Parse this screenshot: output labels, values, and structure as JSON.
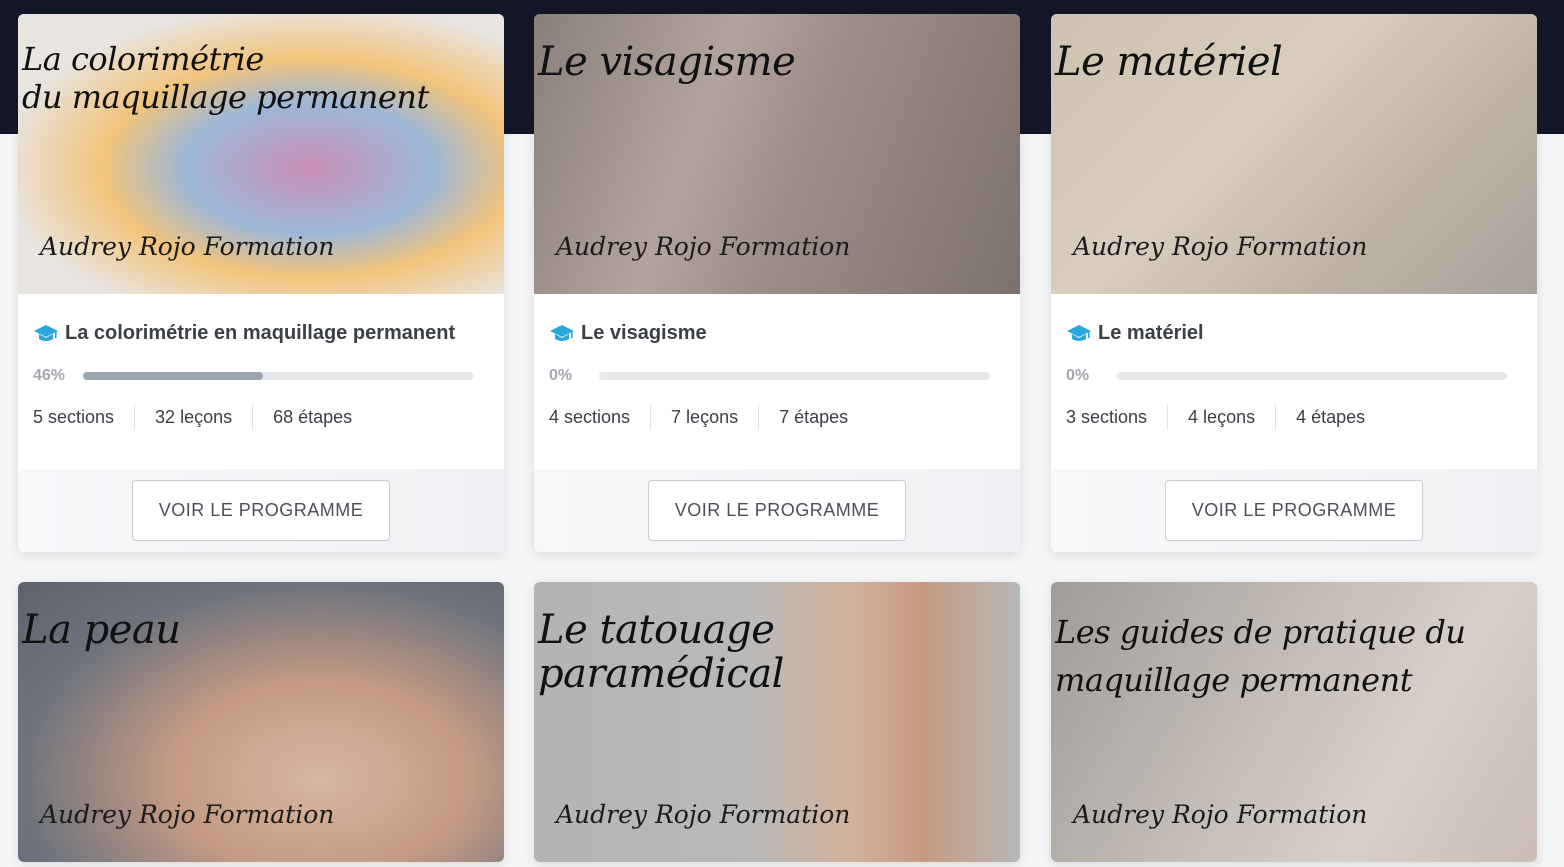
{
  "signature": "Audrey Rojo Formation",
  "button_label": "VOIR LE PROGRAMME",
  "courses": [
    {
      "image_title": "La colorimétrie\ndu maquillage permanent",
      "title": "La colorimétrie en maquillage permanent",
      "progress_label": "46%",
      "progress_fraction": 0.46,
      "stats": [
        "5 sections",
        "32 leçons",
        "68 étapes"
      ]
    },
    {
      "image_title": "Le visagisme",
      "title": "Le visagisme",
      "progress_label": "0%",
      "progress_fraction": 0,
      "stats": [
        "4 sections",
        "7 leçons",
        "7 étapes"
      ]
    },
    {
      "image_title": "Le matériel",
      "title": "Le matériel",
      "progress_label": "0%",
      "progress_fraction": 0,
      "stats": [
        "3 sections",
        "4 leçons",
        "4 étapes"
      ]
    },
    {
      "image_title": "La peau"
    },
    {
      "image_title": "Le tatouage\nparamédical"
    },
    {
      "image_title": "Les guides de pratique du\nmaquillage permanent"
    }
  ],
  "colors": {
    "header_band": "#141728",
    "cap_icon": "#2aa6de",
    "progress_fill": "#9ba2b0",
    "progress_track": "#e6e8ec"
  },
  "icons": {
    "course": "graduation-cap-icon"
  }
}
